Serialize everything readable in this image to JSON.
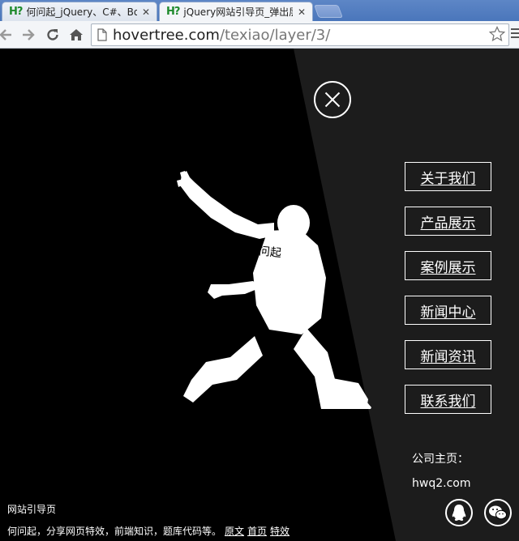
{
  "tabs": [
    {
      "favicon": "H?",
      "title": "何问起_jQuery、C#、Bo",
      "close": "✕"
    },
    {
      "favicon": "H?",
      "title": "jQuery网站引导页_弹出层",
      "close": "✕"
    }
  ],
  "toolbar": {
    "url_host": "hovertree.com",
    "url_path": "/texiao/layer/3/",
    "icons": [
      "back-arrow-icon",
      "forward-arrow-icon",
      "reload-icon",
      "home-icon",
      "page-icon",
      "star-icon",
      "menu-icon"
    ]
  },
  "menu": {
    "items": [
      "关于我们",
      "产品展示",
      "案例展示",
      "新闻中心",
      "新闻资讯",
      "联系我们"
    ]
  },
  "company": {
    "label": "公司主页：",
    "link": "hwq2.com"
  },
  "figure": {
    "shirt_text": "何问起"
  },
  "footer": {
    "title": "网站引导页",
    "description": "何问起，分享网页特效，前端知识，题库代码等。",
    "links": [
      "原文",
      "首页",
      "特效"
    ]
  },
  "colors": {
    "tab_strip": "#4a76bb",
    "page_bg": "#000000",
    "panel_bg": "#1c1c1c",
    "text": "#ffffff"
  }
}
